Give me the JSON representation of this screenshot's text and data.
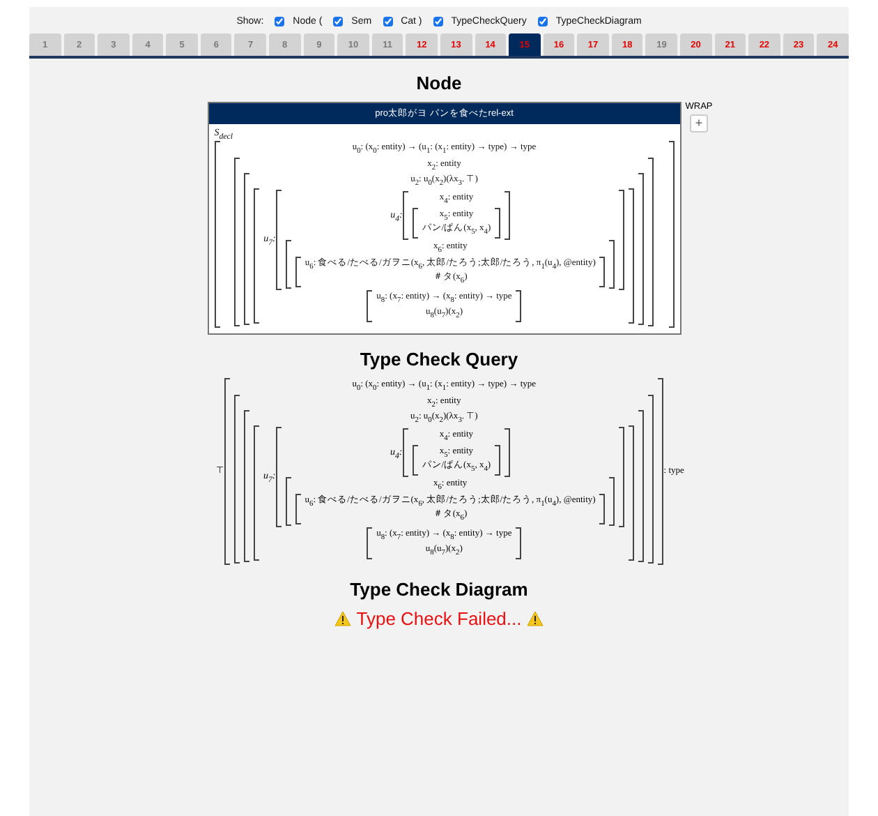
{
  "show": {
    "label": "Show:",
    "options": [
      {
        "label": "Node (",
        "checked": true
      },
      {
        "label": "Sem",
        "checked": true
      },
      {
        "label": "Cat )",
        "checked": true
      },
      {
        "label": "TypeCheckQuery",
        "checked": true
      },
      {
        "label": "TypeCheckDiagram",
        "checked": true
      }
    ]
  },
  "tabs": [
    {
      "label": "1",
      "selected": false,
      "error": false
    },
    {
      "label": "2",
      "selected": false,
      "error": false
    },
    {
      "label": "3",
      "selected": false,
      "error": false
    },
    {
      "label": "4",
      "selected": false,
      "error": false
    },
    {
      "label": "5",
      "selected": false,
      "error": false
    },
    {
      "label": "6",
      "selected": false,
      "error": false
    },
    {
      "label": "7",
      "selected": false,
      "error": false
    },
    {
      "label": "8",
      "selected": false,
      "error": false
    },
    {
      "label": "9",
      "selected": false,
      "error": false
    },
    {
      "label": "10",
      "selected": false,
      "error": false
    },
    {
      "label": "11",
      "selected": false,
      "error": false
    },
    {
      "label": "12",
      "selected": false,
      "error": true
    },
    {
      "label": "13",
      "selected": false,
      "error": true
    },
    {
      "label": "14",
      "selected": false,
      "error": true
    },
    {
      "label": "15",
      "selected": true,
      "error": true
    },
    {
      "label": "16",
      "selected": false,
      "error": true
    },
    {
      "label": "17",
      "selected": false,
      "error": true
    },
    {
      "label": "18",
      "selected": false,
      "error": true
    },
    {
      "label": "19",
      "selected": false,
      "error": false
    },
    {
      "label": "20",
      "selected": false,
      "error": true
    },
    {
      "label": "21",
      "selected": false,
      "error": true
    },
    {
      "label": "22",
      "selected": false,
      "error": true
    },
    {
      "label": "23",
      "selected": false,
      "error": true
    },
    {
      "label": "24",
      "selected": false,
      "error": true
    }
  ],
  "node": {
    "title": "Node",
    "header": "pro太郎がヨ パンを食べたrel-ext",
    "wrap_label": "WRAP",
    "wrap_button": "+",
    "label": "S$_{decl}$",
    "term": {
      "kind": "sigma",
      "items": [
        {
          "kind": "line",
          "text": "u$_{0}$: (x$_{0}$: entity) → (u$_{1}$: (x$_{1}$: entity) → type) → type"
        },
        {
          "kind": "sigma",
          "items": [
            {
              "kind": "line",
              "text": "x$_{2}$: entity"
            },
            {
              "kind": "sigma",
              "items": [
                {
                  "kind": "line",
                  "text": "u$_{2}$: u$_{0}$(x$_{2}$)(λx$_{3}$. ⊤)"
                },
                {
                  "kind": "sigma",
                  "items": [
                    {
                      "kind": "sigma",
                      "label": "u$_{7}$:",
                      "items": [
                        {
                          "kind": "sigma",
                          "label": "u$_{4}$:",
                          "items": [
                            {
                              "kind": "line",
                              "text": "x$_{4}$: entity"
                            },
                            {
                              "kind": "sigma",
                              "items": [
                                {
                                  "kind": "line",
                                  "text": "x$_{5}$: entity"
                                },
                                {
                                  "kind": "line",
                                  "text": "パン/ぱん(x$_{5}$, x$_{4}$)"
                                }
                              ]
                            }
                          ]
                        },
                        {
                          "kind": "sigma",
                          "items": [
                            {
                              "kind": "line",
                              "text": "x$_{6}$: entity"
                            },
                            {
                              "kind": "sigma",
                              "items": [
                                {
                                  "kind": "line",
                                  "text": "u$_{6}$: 食べる/たべる/ガヲニ(x$_{6}$, 太郎/たろう;太郎/たろう, π$_{1}$(u$_{4}$), @entity)"
                                },
                                {
                                  "kind": "line",
                                  "text": "＃タ(x$_{6}$)"
                                }
                              ]
                            }
                          ]
                        }
                      ]
                    },
                    {
                      "kind": "sigma",
                      "items": [
                        {
                          "kind": "line",
                          "text": "u$_{8}$: (x$_{7}$: entity) → (x$_{8}$: entity) → type"
                        },
                        {
                          "kind": "line",
                          "text": "u$_{8}$(u$_{7}$)(x$_{2}$)"
                        }
                      ]
                    }
                  ]
                }
              ]
            }
          ]
        }
      ]
    }
  },
  "query": {
    "title": "Type Check Query",
    "left": "⊤",
    "right": ": type",
    "term": {
      "kind": "sigma",
      "items": [
        {
          "kind": "line",
          "text": "u$_{0}$: (x$_{0}$: entity) → (u$_{1}$: (x$_{1}$: entity) → type) → type"
        },
        {
          "kind": "sigma",
          "items": [
            {
              "kind": "line",
              "text": "x$_{2}$: entity"
            },
            {
              "kind": "sigma",
              "items": [
                {
                  "kind": "line",
                  "text": "u$_{2}$: u$_{0}$(x$_{2}$)(λx$_{3}$. ⊤)"
                },
                {
                  "kind": "sigma",
                  "items": [
                    {
                      "kind": "sigma",
                      "label": "u$_{7}$:",
                      "items": [
                        {
                          "kind": "sigma",
                          "label": "u$_{4}$:",
                          "items": [
                            {
                              "kind": "line",
                              "text": "x$_{4}$: entity"
                            },
                            {
                              "kind": "sigma",
                              "items": [
                                {
                                  "kind": "line",
                                  "text": "x$_{5}$: entity"
                                },
                                {
                                  "kind": "line",
                                  "text": "パン/ぱん(x$_{5}$, x$_{4}$)"
                                }
                              ]
                            }
                          ]
                        },
                        {
                          "kind": "sigma",
                          "items": [
                            {
                              "kind": "line",
                              "text": "x$_{6}$: entity"
                            },
                            {
                              "kind": "sigma",
                              "items": [
                                {
                                  "kind": "line",
                                  "text": "u$_{6}$: 食べる/たべる/ガヲニ(x$_{6}$, 太郎/たろう;太郎/たろう, π$_{1}$(u$_{4}$), @entity)"
                                },
                                {
                                  "kind": "line",
                                  "text": "＃タ(x$_{6}$)"
                                }
                              ]
                            }
                          ]
                        }
                      ]
                    },
                    {
                      "kind": "sigma",
                      "items": [
                        {
                          "kind": "line",
                          "text": "u$_{8}$: (x$_{7}$: entity) → (x$_{8}$: entity) → type"
                        },
                        {
                          "kind": "line",
                          "text": "u$_{8}$(u$_{7}$)(x$_{2}$)"
                        }
                      ]
                    }
                  ]
                }
              ]
            }
          ]
        }
      ]
    }
  },
  "diagram": {
    "title": "Type Check Diagram",
    "message": "Type Check Failed..."
  }
}
